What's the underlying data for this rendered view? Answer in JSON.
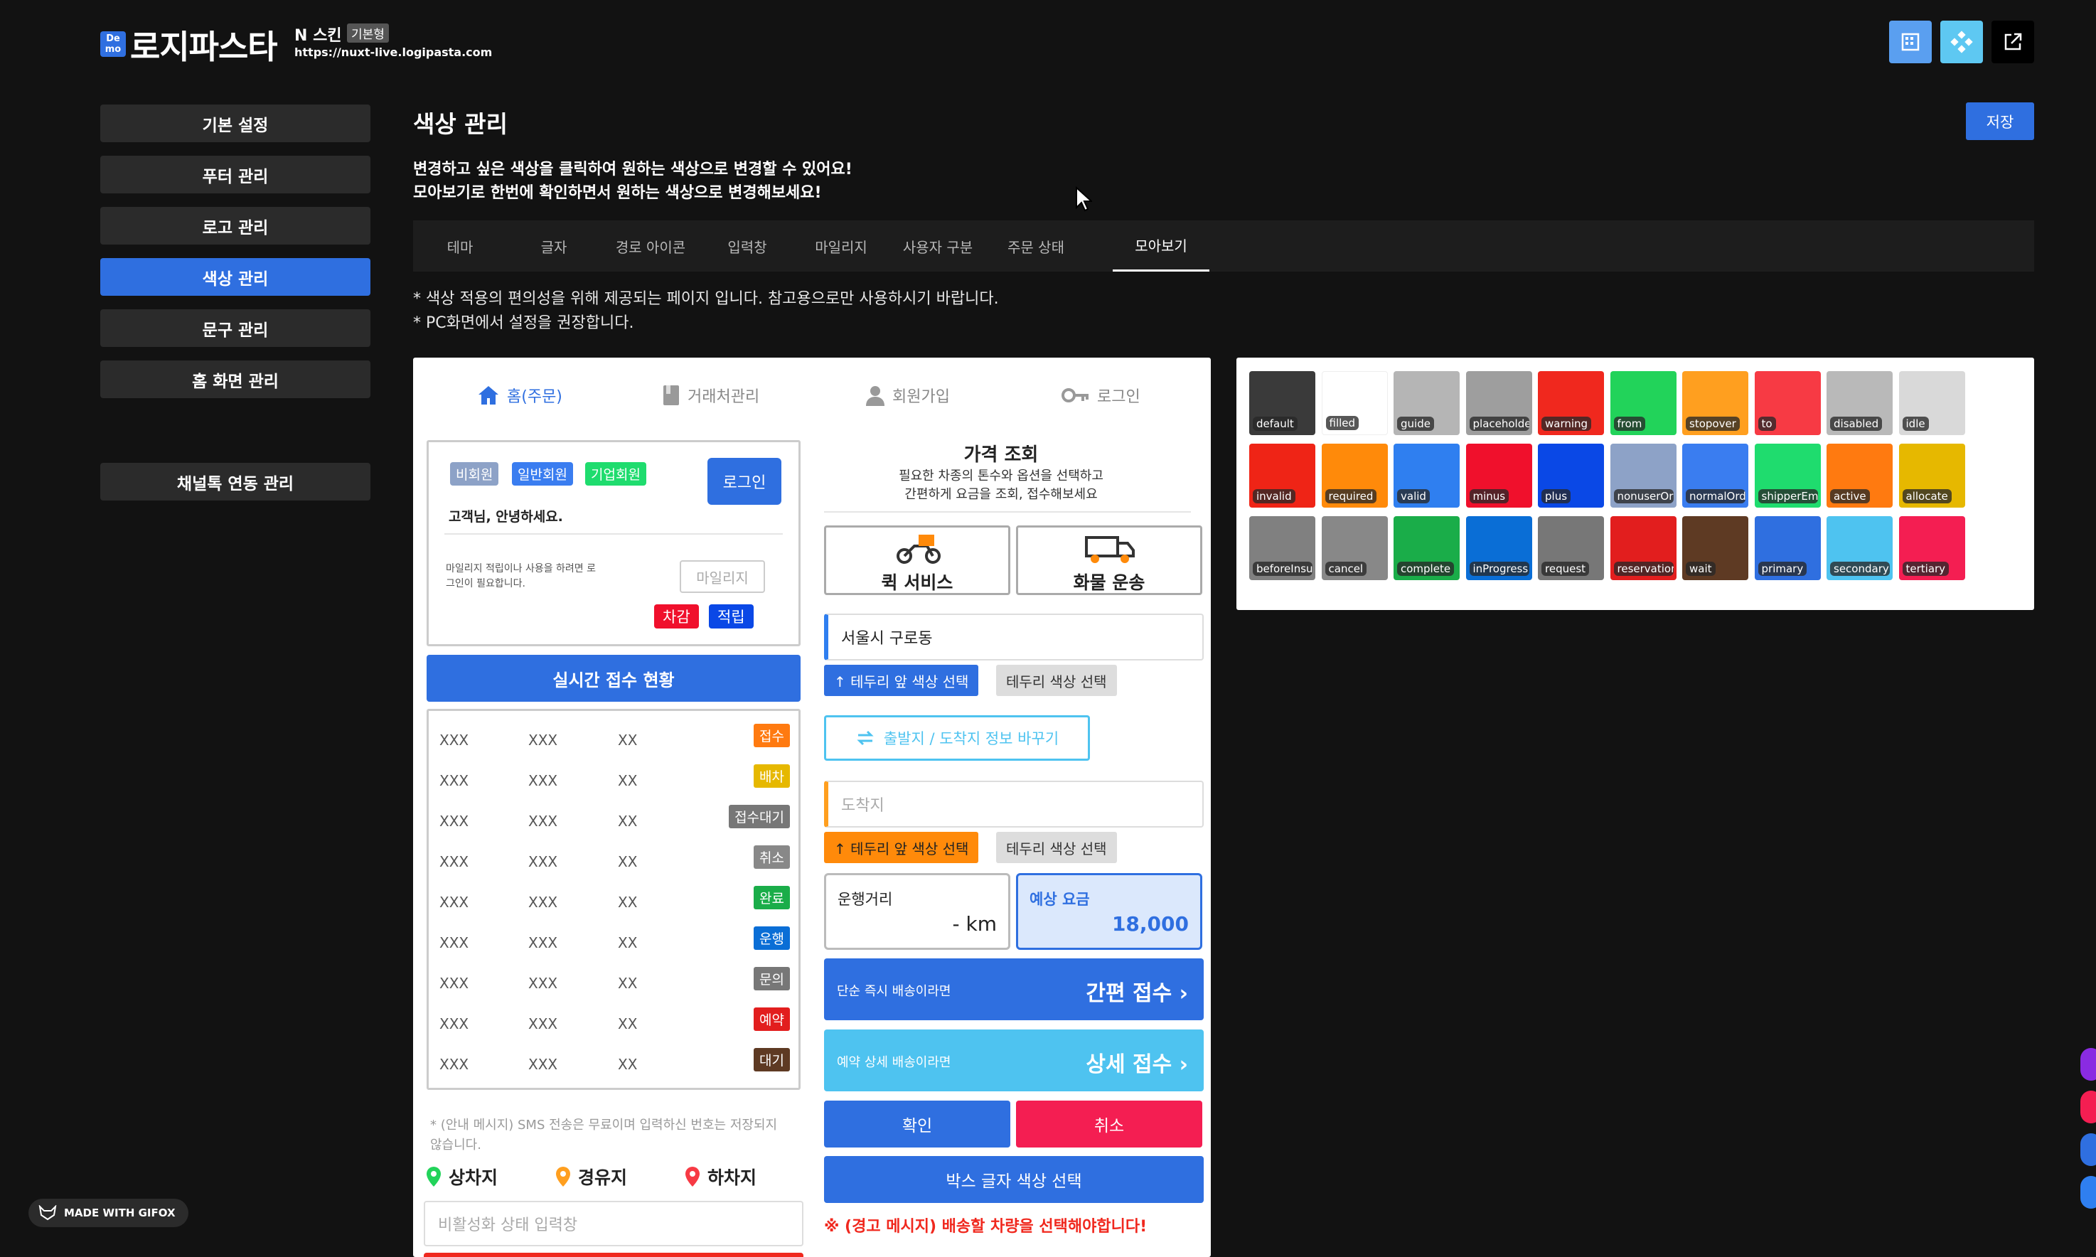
{
  "header": {
    "logo_badge": "De mo",
    "logo_text": "로지파스타",
    "skin_name": "N 스킨",
    "skin_badge": "기본형",
    "url": "https://nuxt-live.logipasta.com"
  },
  "sidebar": {
    "items": [
      {
        "label": "기본 설정"
      },
      {
        "label": "푸터 관리"
      },
      {
        "label": "로고 관리"
      },
      {
        "label": "색상 관리"
      },
      {
        "label": "문구 관리"
      },
      {
        "label": "홈 화면 관리"
      },
      {
        "label": "채널톡 연동 관리"
      }
    ]
  },
  "main": {
    "title": "색상 관리",
    "save": "저장",
    "desc1": "변경하고 싶은 색상을 클릭하여 원하는 색상으로 변경할 수 있어요!",
    "desc2": "모아보기로 한번에 확인하면서 원하는 색상으로 변경해보세요!",
    "tabs": [
      {
        "label": "테마"
      },
      {
        "label": "글자"
      },
      {
        "label": "경로 아이콘"
      },
      {
        "label": "입력창"
      },
      {
        "label": "마일리지"
      },
      {
        "label": "사용자 구분"
      },
      {
        "label": "주문 상태"
      },
      {
        "label": "모아보기"
      }
    ],
    "note1": "* 색상 적용의 편의성을 위해 제공되는 페이지 입니다. 참고용으로만 사용하시기 바랍니다.",
    "note2": "* PC화면에서 설정을 권장합니다."
  },
  "preview": {
    "tabs": [
      {
        "label": "홈(주문)"
      },
      {
        "label": "거래처관리"
      },
      {
        "label": "회원가입"
      },
      {
        "label": "로그인"
      }
    ],
    "member": {
      "nonmember": "비회원",
      "normal": "일반회원",
      "corp": "기업회원",
      "login": "로그인",
      "greeting": "고객님, 안녕하세요.",
      "mileage_note": "마일리지 적립이나 사용을 하려면 로그인이 필요합니다.",
      "mileage_placeholder": "마일리지",
      "deduct": "차감",
      "earn": "적립"
    },
    "realtime": "실시간 접수 현황",
    "rows": [
      {
        "a": "XXX",
        "b": "XXX",
        "c": "XX",
        "status": "접수"
      },
      {
        "a": "XXX",
        "b": "XXX",
        "c": "XX",
        "status": "배차"
      },
      {
        "a": "XXX",
        "b": "XXX",
        "c": "XX",
        "status": "접수대기"
      },
      {
        "a": "XXX",
        "b": "XXX",
        "c": "XX",
        "status": "취소"
      },
      {
        "a": "XXX",
        "b": "XXX",
        "c": "XX",
        "status": "완료"
      },
      {
        "a": "XXX",
        "b": "XXX",
        "c": "XX",
        "status": "운행"
      },
      {
        "a": "XXX",
        "b": "XXX",
        "c": "XX",
        "status": "문의"
      },
      {
        "a": "XXX",
        "b": "XXX",
        "c": "XX",
        "status": "예약"
      },
      {
        "a": "XXX",
        "b": "XXX",
        "c": "XX",
        "status": "대기"
      }
    ],
    "sms_note": "* (안내 메시지) SMS 전송은 무료이며 입력하신 번호는 저장되지 않습니다.",
    "pickup": "상차지",
    "waypoint": "경유지",
    "dropoff": "하차지",
    "disabled_placeholder": "비활성화 상태 입력창",
    "price_title": "가격 조회",
    "price_sub1": "필요한 차종의 톤수와 옵션을 선택하고",
    "price_sub2": "간편하게 요금을 조회, 접수해보세요",
    "quick": "퀵 서비스",
    "cargo": "화물 운송",
    "origin_value": "서울시 구로동",
    "border_front": "↑ 테두리 앞 색상 선택",
    "border": "테두리 색상 선택",
    "swap": "출발지 / 도착지 정보 바꾸기",
    "dest_placeholder": "도착지",
    "distance_label": "운행거리",
    "distance_value": "- km",
    "fare_label": "예상 요금",
    "fare_value": "18,000",
    "simple_sub": "단순 즉시 배송이라면",
    "simple_main": "간편 접수 ›",
    "detail_sub": "예약 상세 배송이라면",
    "detail_main": "상세 접수 ›",
    "confirm": "확인",
    "cancel": "취소",
    "box_text": "박스 글자 색상 선택",
    "warning": "※ (경고 메시지) 배송할 차량을 선택해야합니다!"
  },
  "palette": [
    {
      "name": "default",
      "color": "#3a3a3a"
    },
    {
      "name": "filled",
      "color": "#ffffff"
    },
    {
      "name": "guide",
      "color": "#b5b5b5"
    },
    {
      "name": "placeholder",
      "color": "#9e9e9e"
    },
    {
      "name": "warning",
      "color": "#f0281e"
    },
    {
      "name": "from",
      "color": "#22d35a"
    },
    {
      "name": "stopover",
      "color": "#ff9f1f"
    },
    {
      "name": "to",
      "color": "#f73a44"
    },
    {
      "name": "disabled",
      "color": "#b9b9b9"
    },
    {
      "name": "idle",
      "color": "#d9d9d9"
    },
    {
      "name": "invalid",
      "color": "#ef2416"
    },
    {
      "name": "required",
      "color": "#ff8a0a"
    },
    {
      "name": "valid",
      "color": "#2f7ff0"
    },
    {
      "name": "minus",
      "color": "#f0102c"
    },
    {
      "name": "plus",
      "color": "#0a48e6"
    },
    {
      "name": "nonuserOrder",
      "color": "#8da2c7"
    },
    {
      "name": "normalOrder",
      "color": "#3a7df0"
    },
    {
      "name": "shipperEmp",
      "color": "#1fdc6e"
    },
    {
      "name": "active",
      "color": "#ff7a10"
    },
    {
      "name": "allocate",
      "color": "#e6b800"
    },
    {
      "name": "beforeInsure",
      "color": "#808080"
    },
    {
      "name": "cancel",
      "color": "#888888"
    },
    {
      "name": "complete",
      "color": "#1aad49"
    },
    {
      "name": "inProgress",
      "color": "#0a6ed6"
    },
    {
      "name": "request",
      "color": "#777777"
    },
    {
      "name": "reservation",
      "color": "#e21e1e"
    },
    {
      "name": "wait",
      "color": "#5e3a23"
    },
    {
      "name": "primary",
      "color": "#2f6fe0"
    },
    {
      "name": "secondary",
      "color": "#4ec3f0"
    },
    {
      "name": "tertiary",
      "color": "#f41e52"
    }
  ],
  "gifox": "MADE WITH GIFOX"
}
